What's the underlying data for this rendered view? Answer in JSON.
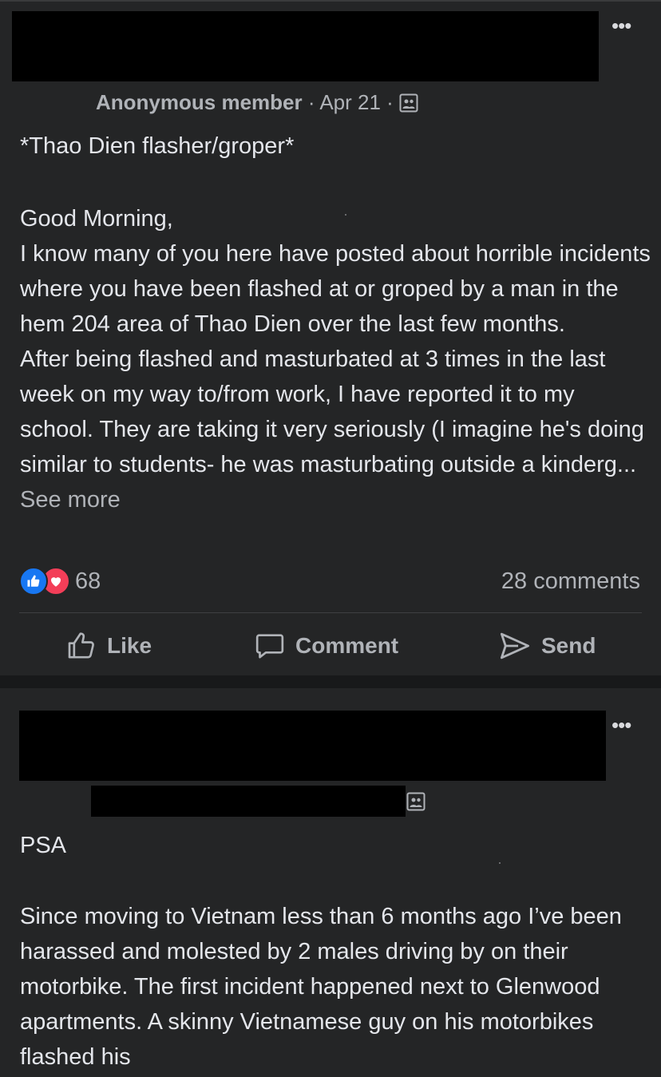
{
  "post1": {
    "author": "Anonymous member",
    "date": "Apr 21",
    "separator": "·",
    "more_icon": "more-dots-icon",
    "group_icon": "group-icon",
    "title": "*Thao Dien flasher/groper*",
    "paragraphs": [
      "Good Morning,",
      "I know many of you here have posted about horrible incidents where you have been flashed at or groped by a man in the hem 204 area of Thao Dien over the last few months.",
      "After being flashed and masturbated at 3 times in the last week on my way to/from work, I have reported it to my school. They are taking it very seriously (I imagine he's doing similar to students- he was masturbating outside a kinderg..."
    ],
    "see_more": "See more",
    "reaction_count": "68",
    "comments": "28 comments",
    "actions": {
      "like": "Like",
      "comment": "Comment",
      "send": "Send"
    },
    "colors": {
      "like_blue": "#1877f2",
      "love_red": "#f33e58"
    }
  },
  "post2": {
    "more_icon": "more-dots-icon",
    "group_icon": "group-icon",
    "title": "PSA",
    "paragraphs": [
      "Since moving to Vietnam less than 6 months ago I’ve been harassed and molested by 2 males driving by on their motorbike. The first incident happened next to Glenwood apartments. A skinny Vietnamese guy on his motorbikes flashed his"
    ]
  }
}
